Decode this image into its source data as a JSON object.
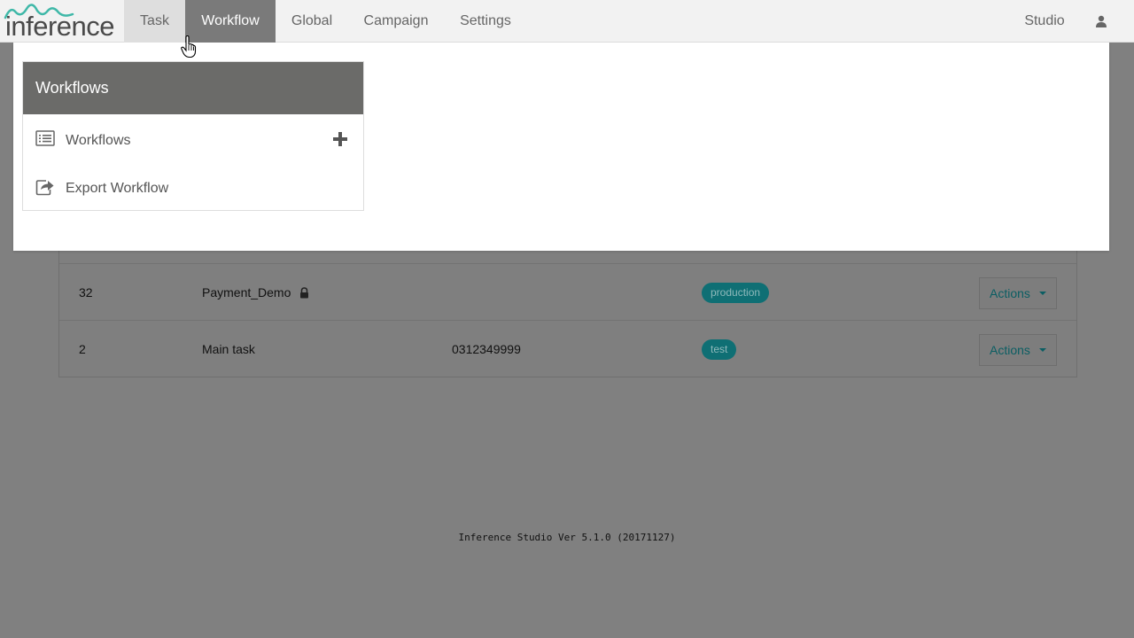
{
  "app": {
    "logo_text": "inference"
  },
  "nav": {
    "items": [
      {
        "label": "Task"
      },
      {
        "label": "Workflow"
      },
      {
        "label": "Global"
      },
      {
        "label": "Campaign"
      },
      {
        "label": "Settings"
      }
    ],
    "right_label": "Studio",
    "user_icon": "user-icon",
    "active": "Workflow"
  },
  "dropdown": {
    "header": "Workflows",
    "items": [
      {
        "label": "Workflows",
        "icon": "list-icon",
        "action_icon": "plus-icon"
      },
      {
        "label": "Export Workflow",
        "icon": "export-icon"
      }
    ]
  },
  "table": {
    "rows": [
      {
        "id": "32",
        "name": "Payment_Demo",
        "phone": "",
        "locked": true,
        "tag": "production",
        "action": "Actions"
      },
      {
        "id": "2",
        "name": "Main task",
        "phone": "0312349999",
        "locked": false,
        "tag": "test",
        "action": "Actions"
      }
    ]
  },
  "footer": {
    "version": "Inference Studio Ver 5.1.0 (20171127)"
  },
  "colors": {
    "accent": "#1aacb2",
    "nav_active_bg": "#7a7a7a",
    "panel_header_bg": "#6b6b69",
    "overlay_bg": "#808080"
  }
}
